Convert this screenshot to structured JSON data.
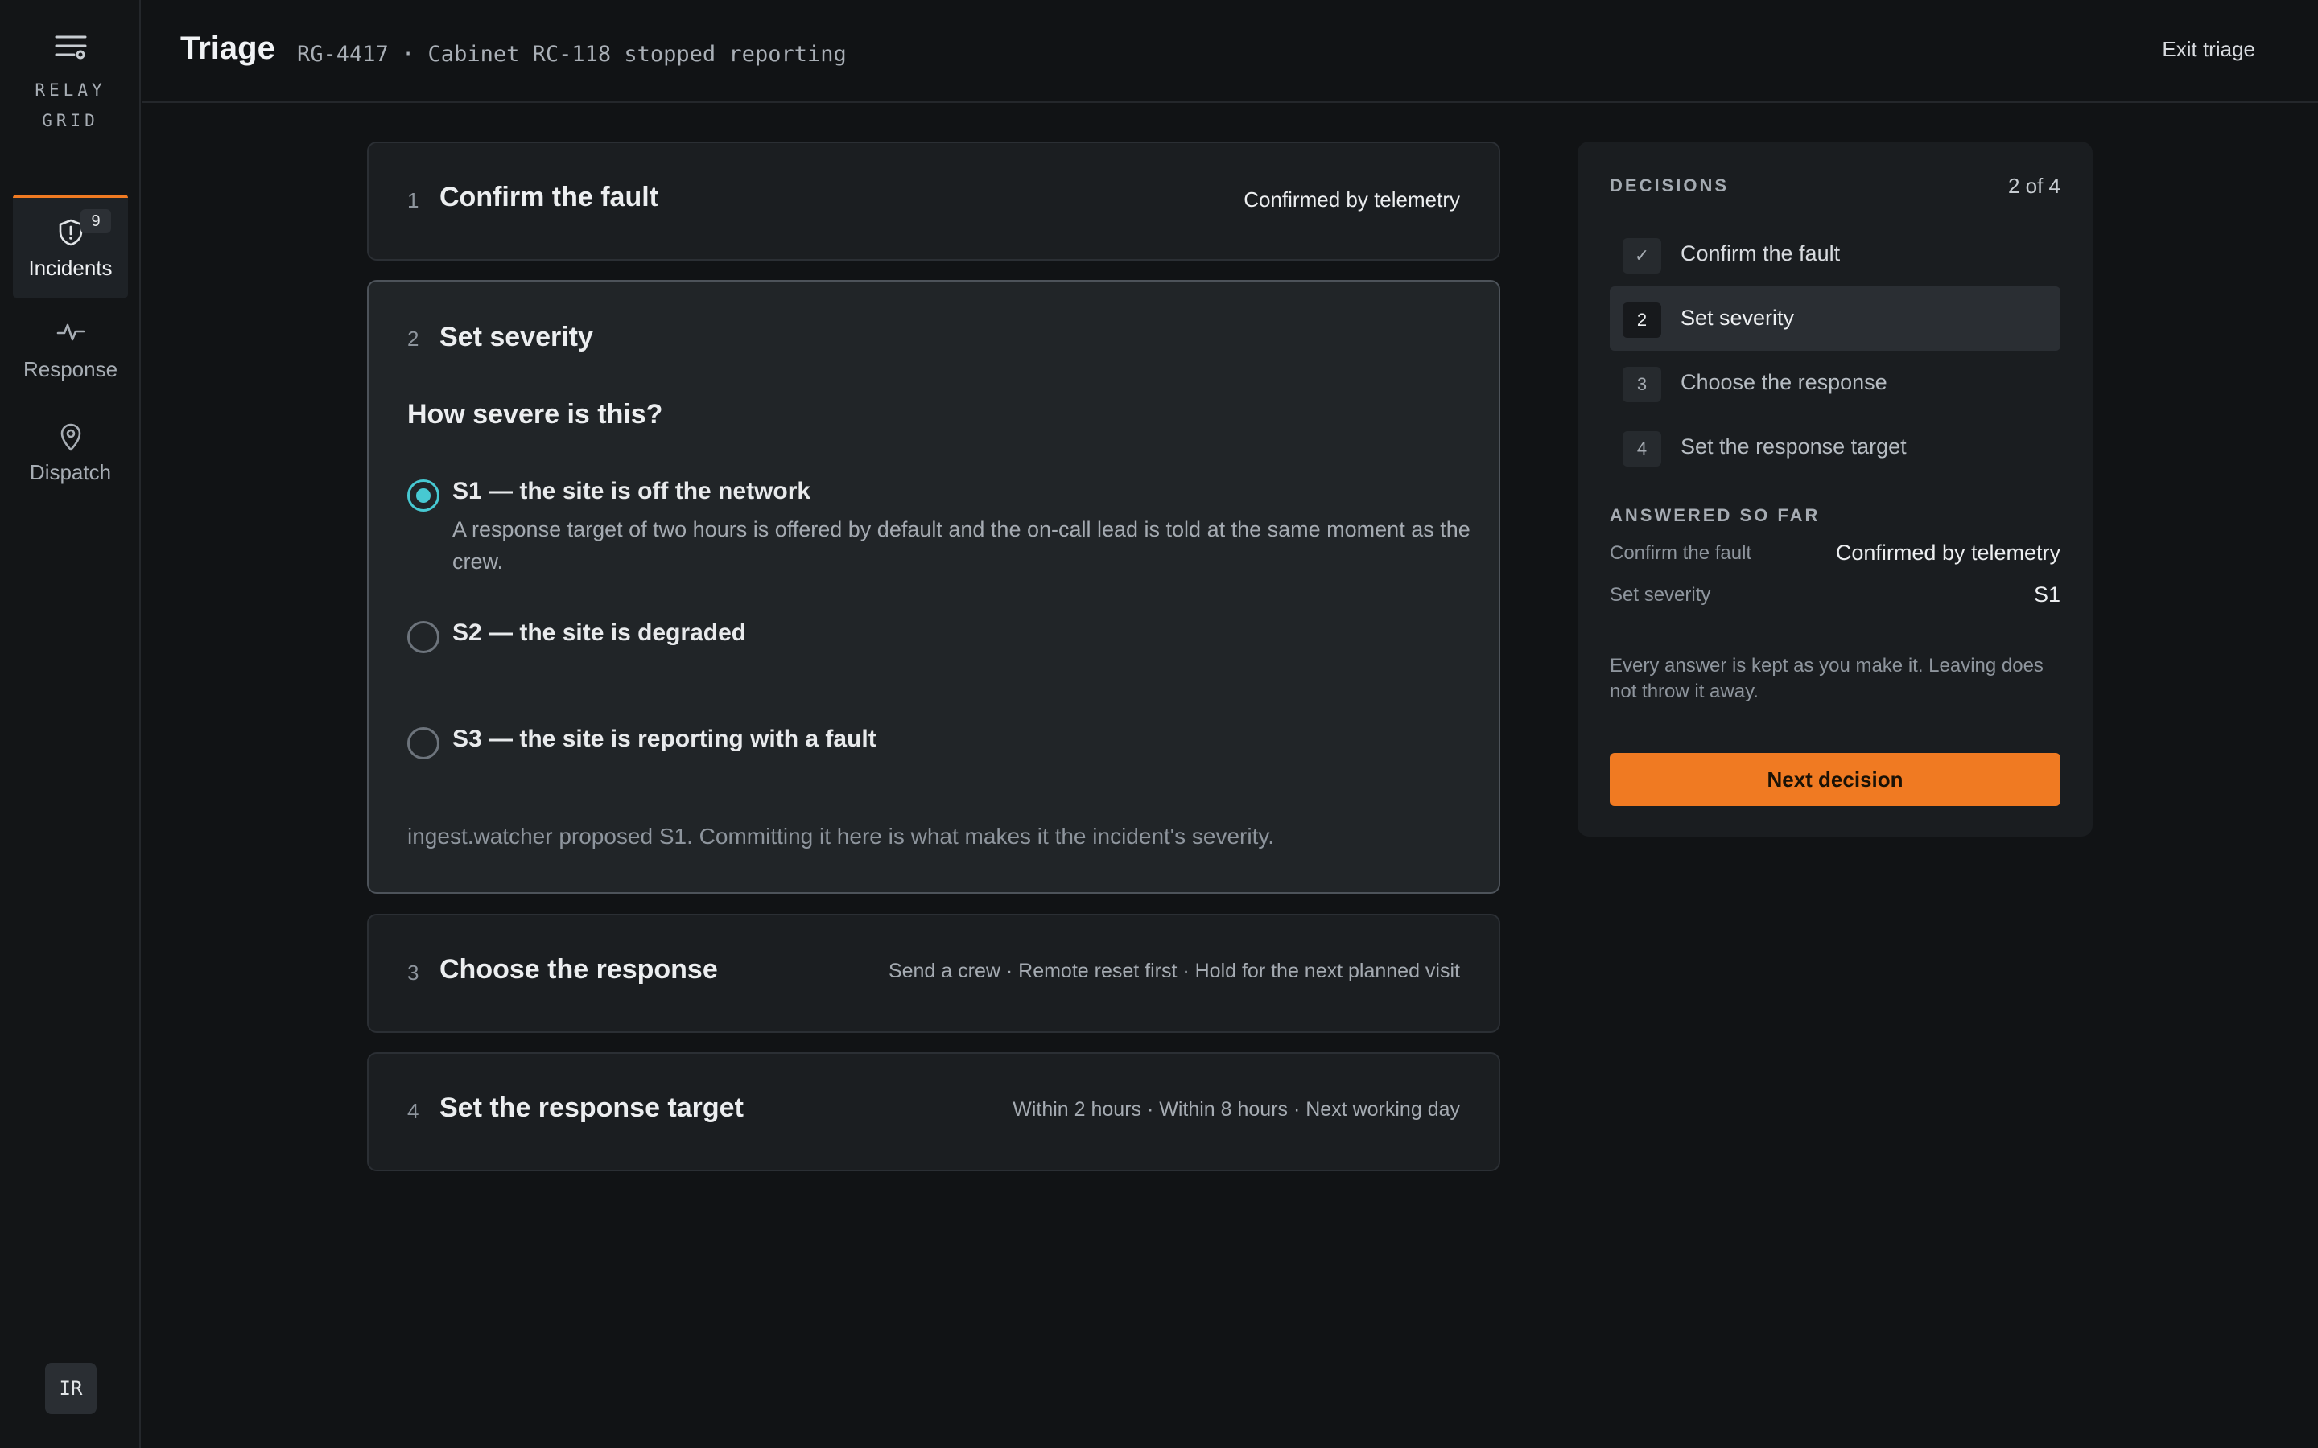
{
  "app": {
    "brand_line1": "RELAY",
    "brand_line2": "GRID",
    "accent_color": "#f07a22",
    "selection_color": "#47c9d2"
  },
  "sidebar": {
    "items": [
      {
        "label": "Incidents",
        "icon": "alert-shield-icon",
        "badge": "9",
        "active": true
      },
      {
        "label": "Response",
        "icon": "activity-pulse-icon",
        "active": false
      },
      {
        "label": "Dispatch",
        "icon": "map-pin-icon",
        "active": false
      }
    ],
    "avatar_initials": "IR"
  },
  "header": {
    "title": "Triage",
    "subtitle": "RG-4417 · Cabinet RC-118 stopped reporting",
    "exit_label": "Exit triage"
  },
  "steps": [
    {
      "number": "1",
      "title": "Confirm the fault",
      "summary": "Confirmed by telemetry"
    },
    {
      "number": "2",
      "title": "Set severity",
      "question": "How severe is this?",
      "options": [
        {
          "label": "S1 — the site is off the network",
          "description": "A response target of two hours is offered by default and the on-call lead is told at the same moment as the crew.",
          "selected": true
        },
        {
          "label": "S2 — the site is degraded",
          "selected": false
        },
        {
          "label": "S3 — the site is reporting with a fault",
          "selected": false
        }
      ],
      "note": "ingest.watcher proposed S1. Committing it here is what makes it the incident's severity."
    },
    {
      "number": "3",
      "title": "Choose the response",
      "summary": "Send a crew · Remote reset first · Hold for the next planned visit"
    },
    {
      "number": "4",
      "title": "Set the response target",
      "summary": "Within 2 hours · Within 8 hours · Next working day"
    }
  ],
  "decisions": {
    "heading": "DECISIONS",
    "count": "2 of 4",
    "items": [
      {
        "marker": "✓",
        "label": "Confirm the fault",
        "state": "done"
      },
      {
        "marker": "2",
        "label": "Set severity",
        "state": "current"
      },
      {
        "marker": "3",
        "label": "Choose the response",
        "state": "pending"
      },
      {
        "marker": "4",
        "label": "Set the response target",
        "state": "pending"
      }
    ],
    "answered_heading": "ANSWERED SO FAR",
    "answered": [
      {
        "key": "Confirm the fault",
        "value": "Confirmed by telemetry"
      },
      {
        "key": "Set severity",
        "value": "S1"
      }
    ],
    "note": "Every answer is kept as you make it. Leaving does not throw it away.",
    "next_label": "Next decision"
  }
}
